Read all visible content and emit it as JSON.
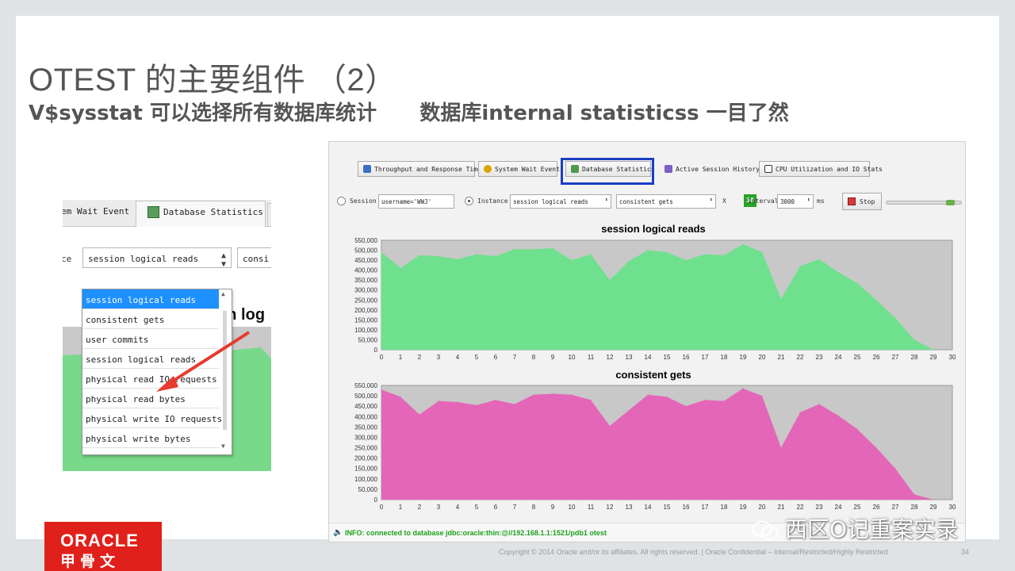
{
  "slide": {
    "title": "OTEST 的主要组件 （2）",
    "subtitle_a": "V$sysstat 可以选择所有数据库统计",
    "subtitle_b": "数据库internal statisticss 一目了然",
    "copyright": "Copyright © 2014 Oracle and/or its affiliates. All rights reserved.  |  Oracle Confidential – Internal/Restricted/Highly Restricted",
    "page_number": "34",
    "logo_text": "ORACLE",
    "logo_cn": "甲骨文",
    "watermark": "西区O记重案实录"
  },
  "zoom": {
    "tab_left": "em Wait Event",
    "tab_active": "Database Statistics",
    "label": "ce",
    "selected": "session logical reads",
    "second_select": "consi",
    "chart_title_fragment": "session log",
    "dropdown": [
      "session logical reads",
      "consistent gets",
      "user commits",
      "session logical reads",
      "physical read IO requests",
      "physical read bytes",
      "physical write IO requests",
      "physical write bytes"
    ]
  },
  "app": {
    "tabs": [
      {
        "label": "Throughput and Response Time",
        "icon": "throughput-icon",
        "color": "#3a6fc4"
      },
      {
        "label": "System Wait Event",
        "icon": "wait-event-icon",
        "color": "#d9a400"
      },
      {
        "label": "Database Statistics",
        "icon": "database-statistics-icon",
        "color": "#4f9a4f"
      },
      {
        "label": "Active Session History",
        "icon": "active-session-icon",
        "color": "#7a5fc4"
      },
      {
        "label": "CPU Utilization and IO Stats",
        "icon": "cpu-icon",
        "color": "#333333"
      }
    ],
    "session_label": "Session",
    "session_value": "username='WWJ'",
    "instance_label": "Instance",
    "stat1": "session logical reads",
    "stat2": "consistent gets",
    "x_label": "X",
    "x_value": "30",
    "interval_label": "Interval",
    "interval_value": "3000",
    "ms_label": "ms",
    "stop_label": "Stop",
    "status": "INFO: connected to database jdbc:oracle:thin:@//192.168.1.1:1521/pdb1  otest"
  },
  "chart_data": [
    {
      "type": "area",
      "title": "session logical reads",
      "x": [
        0,
        1,
        2,
        3,
        4,
        5,
        6,
        7,
        8,
        9,
        10,
        11,
        12,
        13,
        14,
        15,
        16,
        17,
        18,
        19,
        20,
        21,
        22,
        23,
        24,
        25,
        26,
        27,
        28,
        29,
        30
      ],
      "values": [
        490000,
        410000,
        475000,
        470000,
        455000,
        480000,
        470000,
        505000,
        505000,
        510000,
        450000,
        480000,
        350000,
        445000,
        500000,
        490000,
        450000,
        480000,
        475000,
        530000,
        490000,
        255000,
        420000,
        455000,
        390000,
        335000,
        250000,
        160000,
        50000,
        0,
        0
      ],
      "ylim": [
        0,
        550000
      ],
      "yticks": [
        0,
        50000,
        100000,
        150000,
        200000,
        250000,
        300000,
        350000,
        400000,
        450000,
        500000,
        550000
      ],
      "ytick_labels": [
        "0",
        "50,000",
        "100,000",
        "150,000",
        "200,000",
        "250,000",
        "300,000",
        "350,000",
        "400,000",
        "450,000",
        "500,000",
        "550,000"
      ],
      "color": "#6fe08d",
      "grid": false
    },
    {
      "type": "area",
      "title": "consistent gets",
      "x": [
        0,
        1,
        2,
        3,
        4,
        5,
        6,
        7,
        8,
        9,
        10,
        11,
        12,
        13,
        14,
        15,
        16,
        17,
        18,
        19,
        20,
        21,
        22,
        23,
        24,
        25,
        26,
        27,
        28,
        29,
        30
      ],
      "values": [
        530000,
        495000,
        410000,
        475000,
        470000,
        455000,
        480000,
        460000,
        505000,
        510000,
        505000,
        480000,
        355000,
        430000,
        505000,
        495000,
        450000,
        480000,
        475000,
        535000,
        500000,
        250000,
        420000,
        460000,
        405000,
        340000,
        250000,
        150000,
        25000,
        0,
        0
      ],
      "ylim": [
        0,
        550000
      ],
      "yticks": [
        0,
        50000,
        100000,
        150000,
        200000,
        250000,
        300000,
        350000,
        400000,
        450000,
        500000,
        550000
      ],
      "ytick_labels": [
        "0",
        "50,000",
        "100,000",
        "150,000",
        "200,000",
        "250,000",
        "300,000",
        "350,000",
        "400,000",
        "450,000",
        "500,000",
        "550,000"
      ],
      "color": "#e466b8",
      "grid": false
    }
  ]
}
